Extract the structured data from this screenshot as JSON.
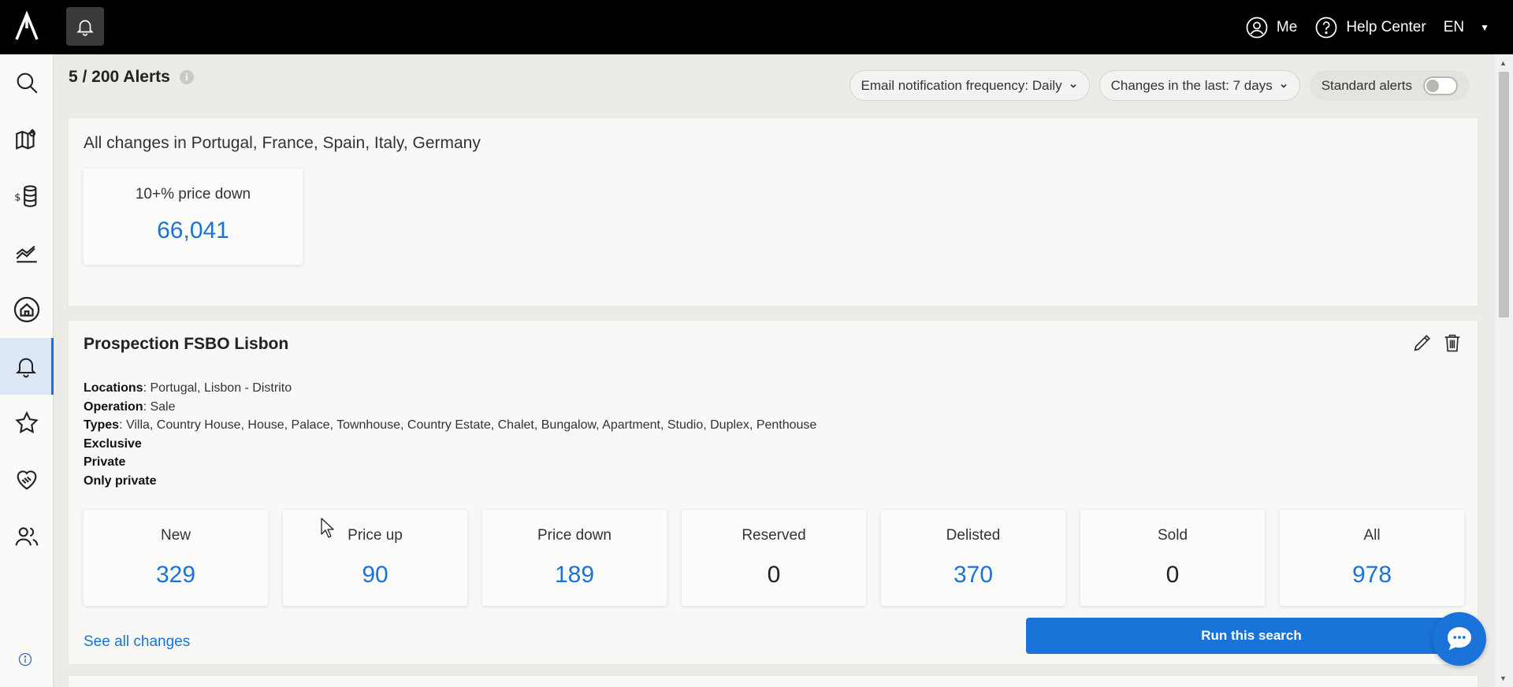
{
  "header": {
    "me_label": "Me",
    "help_label": "Help Center",
    "lang_label": "EN"
  },
  "sidebar": {
    "items": [
      {
        "icon": "search-icon"
      },
      {
        "icon": "map-icon"
      },
      {
        "icon": "valuation-icon"
      },
      {
        "icon": "market-chart-icon"
      },
      {
        "icon": "property-icon"
      },
      {
        "icon": "bell-icon",
        "active": true
      },
      {
        "icon": "star-icon"
      },
      {
        "icon": "handshake-icon"
      },
      {
        "icon": "users-icon"
      }
    ]
  },
  "page": {
    "title": "5 / 200 Alerts",
    "email_frequency": "Email notification frequency: Daily",
    "changes_range": "Changes in the last: 7 days",
    "standard_alerts_label": "Standard alerts",
    "standard_alerts_on": false
  },
  "overview": {
    "title": "All changes in Portugal, France, Spain, Italy, Germany",
    "stat_label": "10+% price down",
    "stat_value": "66,041"
  },
  "alert": {
    "title": "Prospection FSBO Lisbon",
    "locations_key": "Locations",
    "locations_value": ": Portugal, Lisbon - Distrito",
    "operation_key": "Operation",
    "operation_value": ": Sale",
    "types_key": "Types",
    "types_value": ": Villa, Country House, House, Palace, Townhouse, Country Estate, Chalet, Bungalow, Apartment, Studio, Duplex, Penthouse",
    "flag1": "Exclusive",
    "flag2": "Private",
    "flag3": "Only private",
    "stats": [
      {
        "label": "New",
        "value": "329"
      },
      {
        "label": "Price up",
        "value": "90"
      },
      {
        "label": "Price down",
        "value": "189"
      },
      {
        "label": "Reserved",
        "value": "0"
      },
      {
        "label": "Delisted",
        "value": "370"
      },
      {
        "label": "Sold",
        "value": "0"
      },
      {
        "label": "All",
        "value": "978"
      }
    ],
    "see_all": "See all changes",
    "run_button": "Run this search"
  },
  "colors": {
    "accent": "#1a73d9",
    "topbar": "#000000"
  }
}
